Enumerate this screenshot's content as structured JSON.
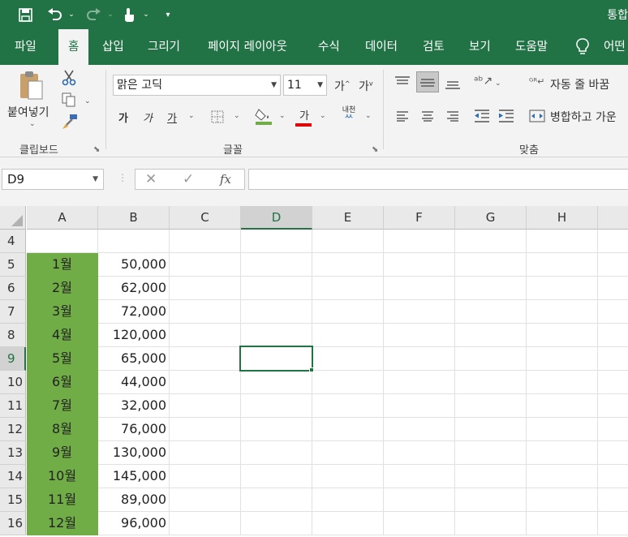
{
  "title_text": "통합",
  "menu_tabs": [
    "파일",
    "홈",
    "삽입",
    "그리기",
    "페이지 레이아웃",
    "수식",
    "데이터",
    "검토",
    "보기",
    "도움말",
    "어떤"
  ],
  "active_tab": "홈",
  "ribbon": {
    "clipboard": {
      "paste_label": "붙여넣기",
      "group_label": "클립보드"
    },
    "font": {
      "font_name": "맑은 고딕",
      "font_size": "11",
      "grow_glyph": "가",
      "shrink_glyph": "가",
      "bold_glyph": "가",
      "italic_glyph": "가",
      "underline_glyph": "가",
      "font_color_glyph": "가",
      "phonetic_glyph": "내천",
      "group_label": "글꼴"
    },
    "alignment": {
      "wrap_text_label": "자동 줄 바꿈",
      "merge_label": "병합하고 가운",
      "group_label": "맞춤"
    }
  },
  "formula_bar": {
    "name_box": "D9",
    "formula": "",
    "fx_label": "fx"
  },
  "columns": [
    "A",
    "B",
    "C",
    "D",
    "E",
    "F",
    "G",
    "H"
  ],
  "selected_column": "D",
  "selected_row": "9",
  "rows": [
    {
      "num": "4",
      "a": "",
      "b": ""
    },
    {
      "num": "5",
      "a": "1월",
      "b": "50,000"
    },
    {
      "num": "6",
      "a": "2월",
      "b": "62,000"
    },
    {
      "num": "7",
      "a": "3월",
      "b": "72,000"
    },
    {
      "num": "8",
      "a": "4월",
      "b": "120,000"
    },
    {
      "num": "9",
      "a": "5월",
      "b": "65,000"
    },
    {
      "num": "10",
      "a": "6월",
      "b": "44,000"
    },
    {
      "num": "11",
      "a": "7월",
      "b": "32,000"
    },
    {
      "num": "12",
      "a": "8월",
      "b": "76,000"
    },
    {
      "num": "13",
      "a": "9월",
      "b": "130,000"
    },
    {
      "num": "14",
      "a": "10월",
      "b": "145,000"
    },
    {
      "num": "15",
      "a": "11월",
      "b": "89,000"
    },
    {
      "num": "16",
      "a": "12월",
      "b": "96,000"
    }
  ],
  "colors": {
    "brand": "#217346",
    "fill_green": "#70ad47",
    "font_red": "#e00000",
    "fill_green_bar": "#70ad47"
  }
}
